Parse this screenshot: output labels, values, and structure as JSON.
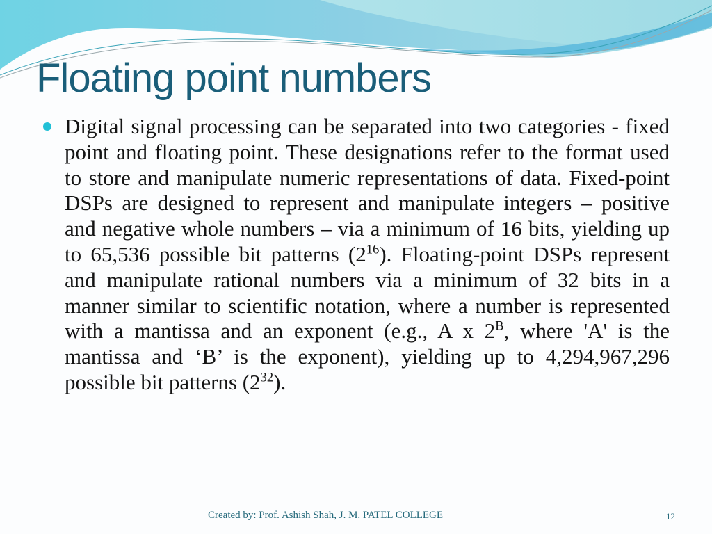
{
  "slide": {
    "title": "Floating point numbers",
    "bullet": {
      "segments": [
        {
          "text": "Digital signal processing can be separated into two categories - fixed point and floating point. These designations refer to the format used to store and manipulate numeric representations of data. Fixed-point DSPs are designed to represent and manipulate integers – positive and negative whole numbers – via a minimum of 16 bits, yielding up to 65,536 possible bit patterns (2"
        },
        {
          "sup": "16"
        },
        {
          "text": "). Floating-point DSPs represent and manipulate rational numbers via a minimum of 32 bits in a manner similar to scientific notation, where a number is represented with a mantissa and an exponent (e.g., A x 2"
        },
        {
          "sup": "B"
        },
        {
          "text": ", where 'A' is the mantissa and ‘B’ is the exponent), yielding up to 4,294,967,296 possible bit patterns (2"
        },
        {
          "sup": "32"
        },
        {
          "text": ")."
        }
      ]
    },
    "footer": {
      "credit": "Created by: Prof. Ashish Shah, J. M. PATEL COLLEGE",
      "page_number": "12"
    },
    "colors": {
      "title": "#1a5e79",
      "bullet": "#21c0d6",
      "footer": "#23687a",
      "wave_light": "#a8dfe6",
      "wave_mid": "#6fcde0",
      "wave_dark": "#4ab3d8"
    }
  }
}
